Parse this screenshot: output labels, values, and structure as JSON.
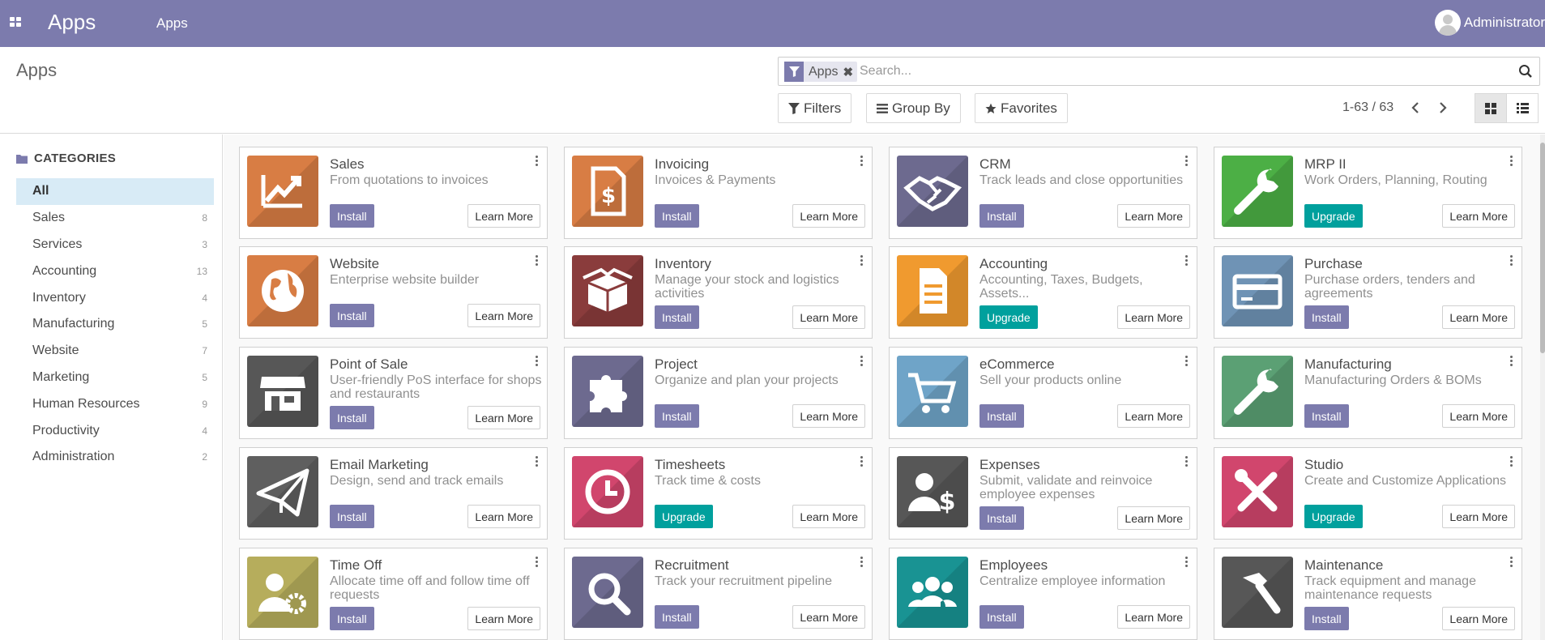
{
  "topbar": {
    "brand": "Apps",
    "menu_item": "Apps",
    "user": "Administrator"
  },
  "control_panel": {
    "title": "Apps",
    "facet_label": "Apps",
    "search_placeholder": "Search...",
    "filters": "Filters",
    "group_by": "Group By",
    "favorites": "Favorites",
    "pager": "1-63 / 63"
  },
  "sidebar": {
    "header": "CATEGORIES",
    "items": [
      {
        "label": "All",
        "count": ""
      },
      {
        "label": "Sales",
        "count": "8"
      },
      {
        "label": "Services",
        "count": "3"
      },
      {
        "label": "Accounting",
        "count": "13"
      },
      {
        "label": "Inventory",
        "count": "4"
      },
      {
        "label": "Manufacturing",
        "count": "5"
      },
      {
        "label": "Website",
        "count": "7"
      },
      {
        "label": "Marketing",
        "count": "5"
      },
      {
        "label": "Human Resources",
        "count": "9"
      },
      {
        "label": "Productivity",
        "count": "4"
      },
      {
        "label": "Administration",
        "count": "2"
      }
    ]
  },
  "apps": [
    {
      "name": "Sales",
      "desc": "From quotations to invoices",
      "action": "Install",
      "learn": "Learn More",
      "icon": "chart-trend-icon",
      "color": "#d87d44"
    },
    {
      "name": "Invoicing",
      "desc": "Invoices & Payments",
      "action": "Install",
      "learn": "Learn More",
      "icon": "invoice-dollar-icon",
      "color": "#d87d44"
    },
    {
      "name": "CRM",
      "desc": "Track leads and close opportunities",
      "action": "Install",
      "learn": "Learn More",
      "icon": "handshake-icon",
      "color": "#6d6a8f"
    },
    {
      "name": "MRP II",
      "desc": "Work Orders, Planning, Routing",
      "action": "Upgrade",
      "learn": "Learn More",
      "icon": "wrench-icon",
      "color": "#4caf45"
    },
    {
      "name": "Website",
      "desc": "Enterprise website builder",
      "action": "Install",
      "learn": "Learn More",
      "icon": "globe-icon",
      "color": "#d87d44"
    },
    {
      "name": "Inventory",
      "desc": "Manage your stock and logistics activities",
      "action": "Install",
      "learn": "Learn More",
      "icon": "box-icon",
      "color": "#8a3c3c"
    },
    {
      "name": "Accounting",
      "desc": "Accounting, Taxes, Budgets, Assets...",
      "action": "Upgrade",
      "learn": "Learn More",
      "icon": "document-icon",
      "color": "#f09a2f"
    },
    {
      "name": "Purchase",
      "desc": "Purchase orders, tenders and agreements",
      "action": "Install",
      "learn": "Learn More",
      "icon": "credit-card-icon",
      "color": "#6f93b5"
    },
    {
      "name": "Point of Sale",
      "desc": "User-friendly PoS interface for shops and restaurants",
      "action": "Install",
      "learn": "Learn More",
      "icon": "shop-icon",
      "color": "#575757"
    },
    {
      "name": "Project",
      "desc": "Organize and plan your projects",
      "action": "Install",
      "learn": "Learn More",
      "icon": "puzzle-icon",
      "color": "#6d6a8f"
    },
    {
      "name": "eCommerce",
      "desc": "Sell your products online",
      "action": "Install",
      "learn": "Learn More",
      "icon": "cart-icon",
      "color": "#6fa4c8"
    },
    {
      "name": "Manufacturing",
      "desc": "Manufacturing Orders & BOMs",
      "action": "Install",
      "learn": "Learn More",
      "icon": "wrench-icon",
      "color": "#5ba074"
    },
    {
      "name": "Email Marketing",
      "desc": "Design, send and track emails",
      "action": "Install",
      "learn": "Learn More",
      "icon": "paper-plane-icon",
      "color": "#5f5f5f"
    },
    {
      "name": "Timesheets",
      "desc": "Track time & costs",
      "action": "Upgrade",
      "learn": "Learn More",
      "icon": "clock-icon",
      "color": "#d1466d"
    },
    {
      "name": "Expenses",
      "desc": "Submit, validate and reinvoice employee expenses",
      "action": "Install",
      "learn": "Learn More",
      "icon": "user-dollar-icon",
      "color": "#575757"
    },
    {
      "name": "Studio",
      "desc": "Create and Customize Applications",
      "action": "Upgrade",
      "learn": "Learn More",
      "icon": "tools-icon",
      "color": "#d1466d"
    },
    {
      "name": "Time Off",
      "desc": "Allocate time off and follow time off requests",
      "action": "Install",
      "learn": "Learn More",
      "icon": "user-gear-icon",
      "color": "#b6ad5c"
    },
    {
      "name": "Recruitment",
      "desc": "Track your recruitment pipeline",
      "action": "Install",
      "learn": "Learn More",
      "icon": "magnifier-icon",
      "color": "#6d6a8f"
    },
    {
      "name": "Employees",
      "desc": "Centralize employee information",
      "action": "Install",
      "learn": "Learn More",
      "icon": "users-icon",
      "color": "#199393"
    },
    {
      "name": "Maintenance",
      "desc": "Track equipment and manage maintenance requests",
      "action": "Install",
      "learn": "Learn More",
      "icon": "hammer-icon",
      "color": "#575757"
    }
  ]
}
